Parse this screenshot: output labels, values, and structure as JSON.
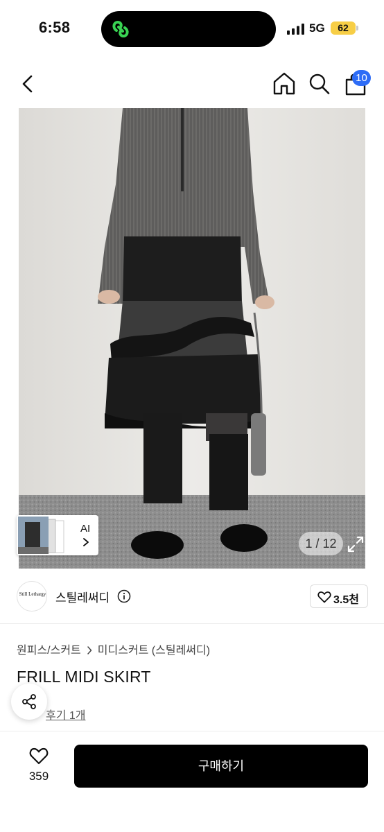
{
  "status_bar": {
    "time": "6:58",
    "network": "5G",
    "battery": "62"
  },
  "nav": {
    "icons": [
      "chevron-left-icon",
      "home-icon",
      "search-icon",
      "shopping-bag-icon"
    ],
    "cart_badge": "10"
  },
  "gallery": {
    "ai_label": "AI",
    "page_counter": "1 / 12"
  },
  "seller": {
    "avatar_text": "Still Lethargy",
    "name": "스틸레써디",
    "likes": "3.5천"
  },
  "product": {
    "breadcrumb": [
      "원피스/스커트",
      "미디스커트 (스틸레써디)"
    ],
    "title": "FRILL MIDI SKIRT",
    "review_link": "후기 1개"
  },
  "bottom_bar": {
    "wish_count": "359",
    "buy_label": "구매하기"
  },
  "colors": {
    "accent_blue": "#2d6cf6",
    "battery_yellow": "#f7ce46",
    "buy_button": "#000000"
  }
}
